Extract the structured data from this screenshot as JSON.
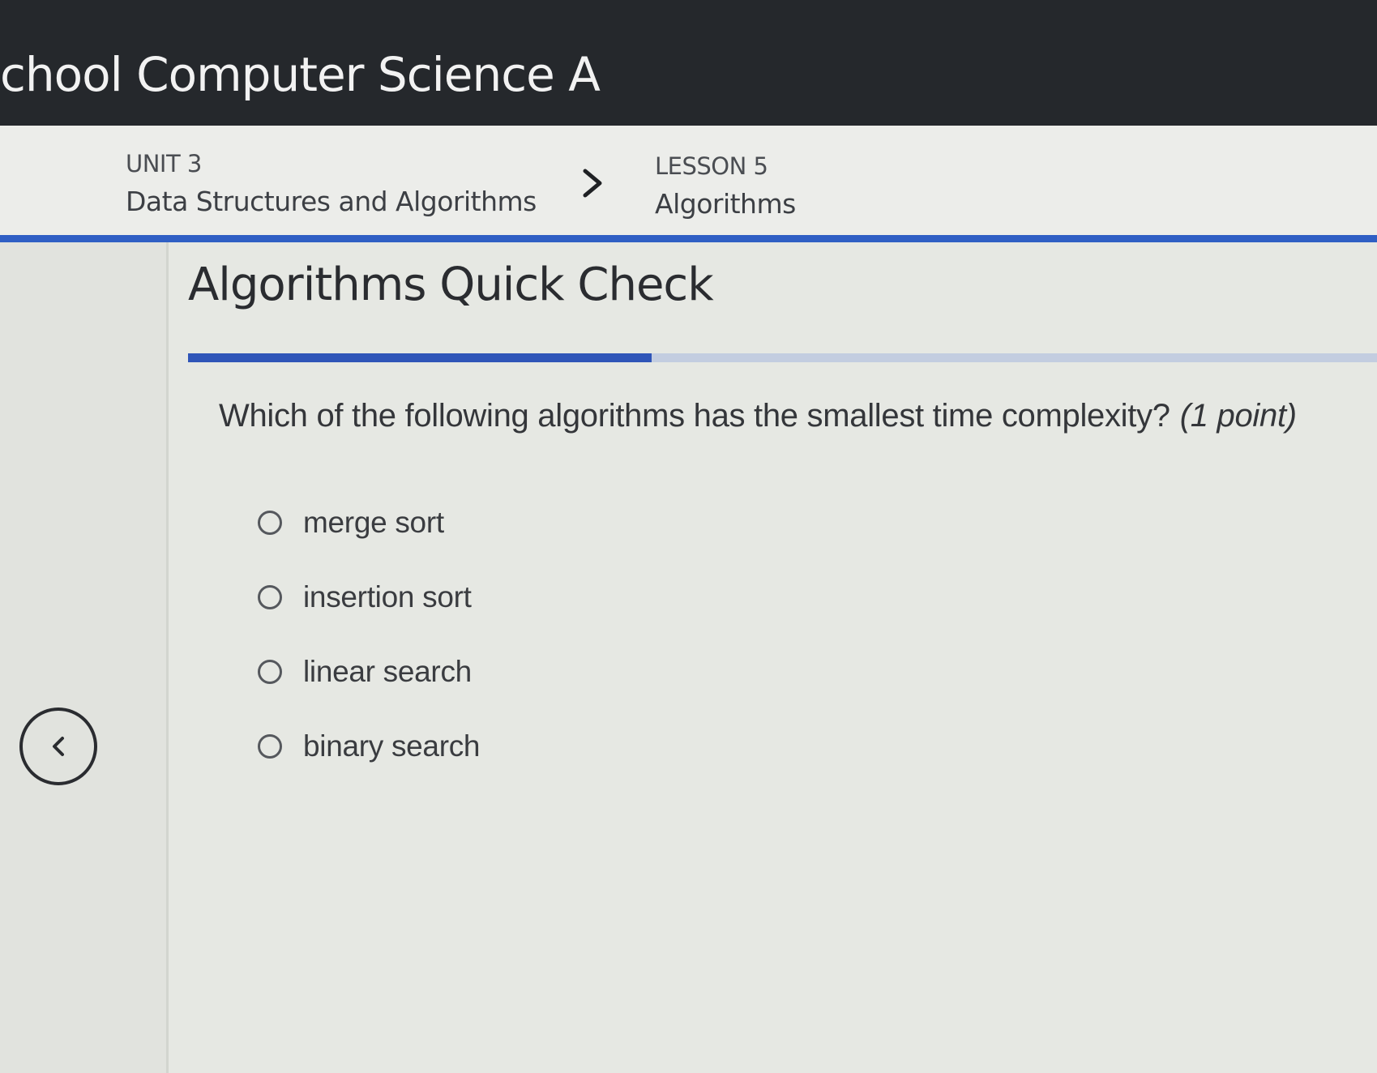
{
  "header": {
    "course_title": "chool Computer Science A"
  },
  "breadcrumb": {
    "unit_label": "UNIT 3",
    "unit_name": "Data Structures and Algorithms",
    "separator_icon": "chevron-right-icon",
    "lesson_label": "LESSON 5",
    "lesson_name": "Algorithms"
  },
  "quiz": {
    "title": "Algorithms Quick Check",
    "progress_fraction": 0.39,
    "question": "Which of the following algorithms has the smallest time complexity?",
    "points": "(1 point)",
    "options": [
      {
        "label": "merge sort",
        "selected": false
      },
      {
        "label": "insertion sort",
        "selected": false
      },
      {
        "label": "linear search",
        "selected": false
      },
      {
        "label": "binary search",
        "selected": false
      }
    ]
  },
  "nav": {
    "back_icon": "chevron-left-icon"
  },
  "colors": {
    "topbar": "#25282c",
    "accent": "#2f55b8",
    "progress_track": "#c3cde0"
  }
}
